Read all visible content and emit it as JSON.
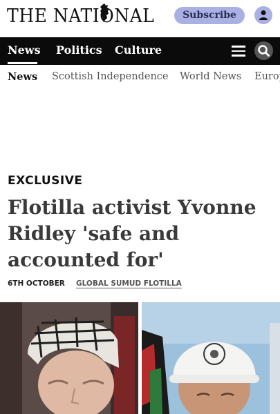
{
  "masthead": {
    "logo_text": "THE NATIONAL",
    "subscribe_label": "Subscribe",
    "account_icon": "person-icon"
  },
  "nav": {
    "items": [
      {
        "label": "News"
      },
      {
        "label": "Politics"
      },
      {
        "label": "Culture"
      }
    ],
    "menu_icon": "hamburger-icon",
    "search_icon": "search-icon"
  },
  "subnav": {
    "items": [
      {
        "label": "News"
      },
      {
        "label": "Scottish Independence"
      },
      {
        "label": "World News"
      },
      {
        "label": "Europe"
      }
    ]
  },
  "article": {
    "kicker": "EXCLUSIVE",
    "headline": "Flotilla activist Yvonne Ridley 'safe and accounted for'",
    "date": "6TH OCTOBER",
    "tag": "GLOBAL SUMUD FLOTILLA"
  },
  "colors": {
    "subscribe_bg": "#aab0e3",
    "nav_bg": "#0b0b0b"
  }
}
